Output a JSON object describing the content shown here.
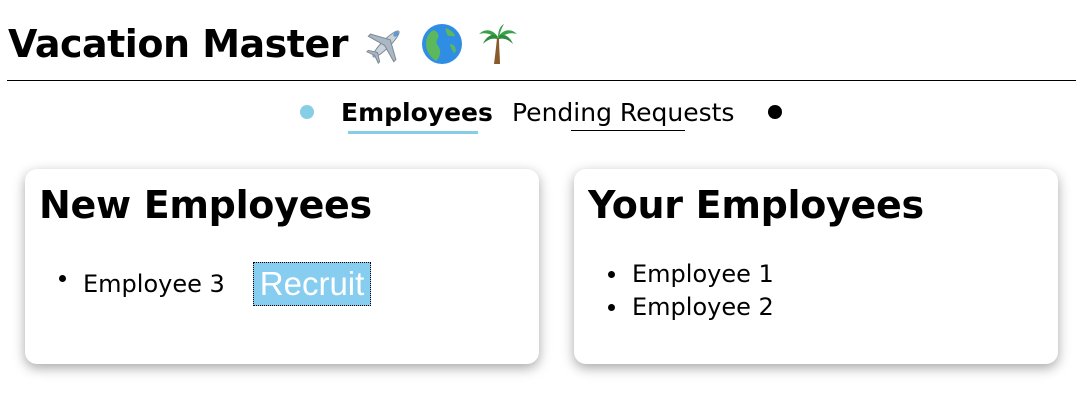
{
  "header": {
    "title": "Vacation Master",
    "emojis": [
      "airplane-icon",
      "globe-icon",
      "palm-tree-icon"
    ]
  },
  "nav": {
    "tabs": [
      {
        "label": "Employees",
        "active": true
      },
      {
        "label": "Pending Requests",
        "active": false
      }
    ],
    "accent_color": "#87cde6"
  },
  "new_employees": {
    "title": "New Employees",
    "items": [
      {
        "name": "Employee 3",
        "action_label": "Recruit"
      }
    ]
  },
  "your_employees": {
    "title": "Your Employees",
    "items": [
      {
        "name": "Employee 1"
      },
      {
        "name": "Employee 2"
      }
    ]
  }
}
